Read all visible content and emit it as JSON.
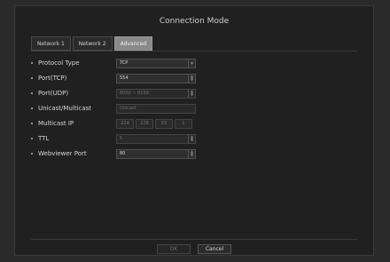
{
  "dialog": {
    "title": "Connection Mode",
    "tabs": [
      {
        "label": "Network 1",
        "active": false
      },
      {
        "label": "Network 2",
        "active": false
      },
      {
        "label": "Advanced",
        "active": true
      }
    ],
    "fields": {
      "protocol_type": {
        "label": "Protocol Type",
        "value": "TCP"
      },
      "port_tcp": {
        "label": "Port(TCP)",
        "value": "554"
      },
      "port_udp": {
        "label": "Port(UDP)",
        "value": "8000 ~ 8159"
      },
      "unicast_multicast": {
        "label": "Unicast/Multicast",
        "value": "Unicast"
      },
      "multicast_ip": {
        "label": "Multicast IP",
        "octets": [
          "224",
          "126",
          "63",
          "1"
        ]
      },
      "ttl": {
        "label": "TTL",
        "value": "5"
      },
      "webviewer_port": {
        "label": "Webviewer Port",
        "value": "80"
      }
    },
    "buttons": {
      "ok": "OK",
      "cancel": "Cancel"
    }
  }
}
